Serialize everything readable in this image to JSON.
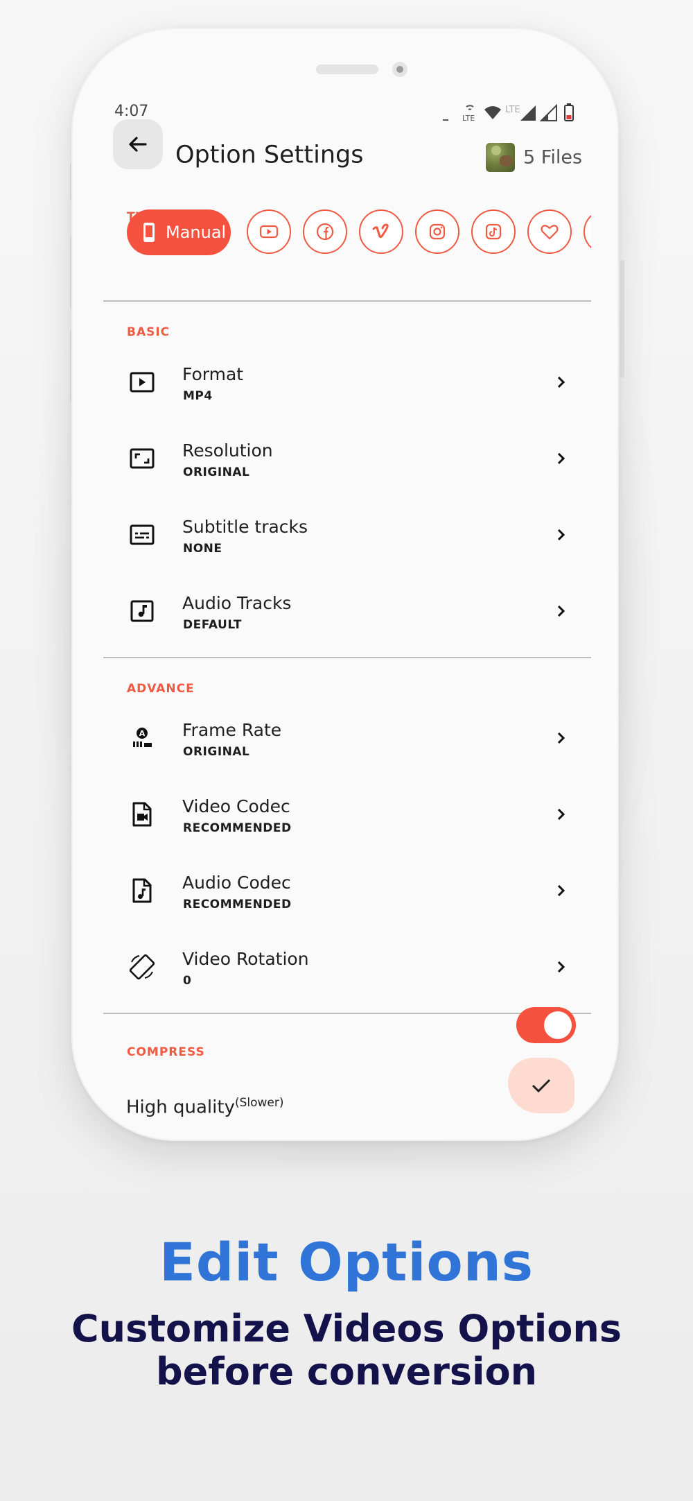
{
  "status_bar": {
    "time": "4:07",
    "lte_label": "LTE",
    "lte_label_small": "LTE"
  },
  "header": {
    "title": "Option Settings",
    "files_label": "5 Files"
  },
  "type_section": {
    "label": "TYPE",
    "chips": [
      {
        "label": "Manual",
        "icon": "phone-icon",
        "selected": true
      },
      {
        "icon": "youtube-icon"
      },
      {
        "icon": "facebook-icon"
      },
      {
        "icon": "vimeo-icon"
      },
      {
        "icon": "instagram-icon"
      },
      {
        "icon": "tiktok-icon"
      },
      {
        "icon": "heart-icon"
      },
      {
        "icon": "more-chip-icon"
      }
    ]
  },
  "basic": {
    "label": "BASIC",
    "items": [
      {
        "name": "Format",
        "value": "MP4",
        "icon": "play-box-icon"
      },
      {
        "name": "Resolution",
        "value": "ORIGINAL",
        "icon": "aspect-ratio-icon"
      },
      {
        "name": "Subtitle tracks",
        "value": "NONE",
        "icon": "subtitles-icon"
      },
      {
        "name": "Audio Tracks",
        "value": "DEFAULT",
        "icon": "music-box-icon"
      }
    ]
  },
  "advance": {
    "label": "ADVANCE",
    "items": [
      {
        "name": "Frame Rate",
        "value": "ORIGINAL",
        "icon": "frame-rate-icon"
      },
      {
        "name": "Video Codec",
        "value": "RECOMMENDED",
        "icon": "video-file-icon"
      },
      {
        "name": "Audio Codec",
        "value": "RECOMMENDED",
        "icon": "audio-file-icon"
      },
      {
        "name": "Video Rotation",
        "value": "0",
        "icon": "screen-rotation-icon"
      }
    ]
  },
  "compress": {
    "label": "COMPRESS",
    "enabled": true,
    "quality_label": "High quality",
    "quality_hint": "(Slower)",
    "checked": true
  },
  "caption": {
    "title": "Edit Options",
    "subtitle_line1": "Customize Videos Options",
    "subtitle_line2": "before conversion"
  },
  "colors": {
    "accent": "#f4523f",
    "caption_title": "#2f74d6",
    "caption_subtitle": "#14124a"
  }
}
